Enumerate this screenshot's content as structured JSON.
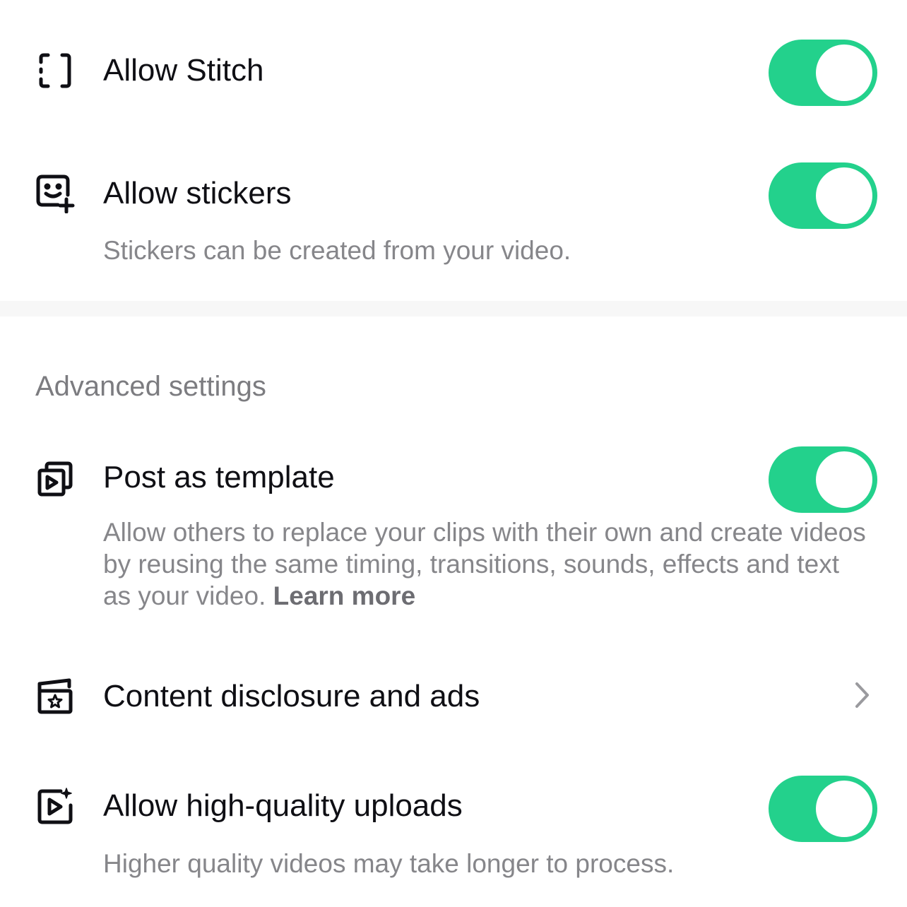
{
  "settings": {
    "allow_stitch": {
      "label": "Allow Stitch",
      "icon": "stitch-icon",
      "enabled": true
    },
    "allow_stickers": {
      "label": "Allow stickers",
      "description": "Stickers can be created from your video.",
      "icon": "sticker-icon",
      "enabled": true
    }
  },
  "advanced": {
    "section_title": "Advanced settings",
    "post_as_template": {
      "label": "Post as template",
      "description": "Allow others to replace your clips with their own and create videos by reusing the same timing, transitions, sounds, effects and text as your video.",
      "learn_more": "Learn more",
      "icon": "template-icon",
      "enabled": true
    },
    "content_disclosure": {
      "label": "Content disclosure and ads",
      "icon": "disclosure-icon",
      "chevron": "chevron-right-icon"
    },
    "high_quality_uploads": {
      "label": "Allow high-quality uploads",
      "description": "Higher quality videos may take longer to process.",
      "icon": "hq-video-icon",
      "enabled": true
    }
  },
  "colors": {
    "toggle_on": "#23d18c",
    "description_text": "#86868a",
    "label_text": "#0f0f14"
  }
}
